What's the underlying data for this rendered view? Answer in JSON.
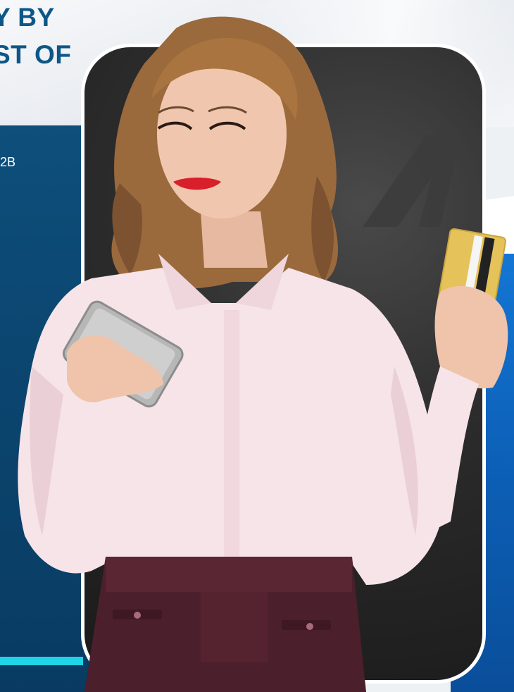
{
  "headline": {
    "line1": "Y BY",
    "line2": "ST OF"
  },
  "subtext": "2B",
  "colors": {
    "headline": "#0d5788",
    "left_panel": "#0b4670",
    "accent": "#21d3e6",
    "right_blue": "#0c5fb6",
    "card_dark": "#2b2b2b"
  },
  "icons": {
    "brand_logo": "brand-logo-icon",
    "phone": "smartphone-icon",
    "card": "credit-card-icon"
  }
}
